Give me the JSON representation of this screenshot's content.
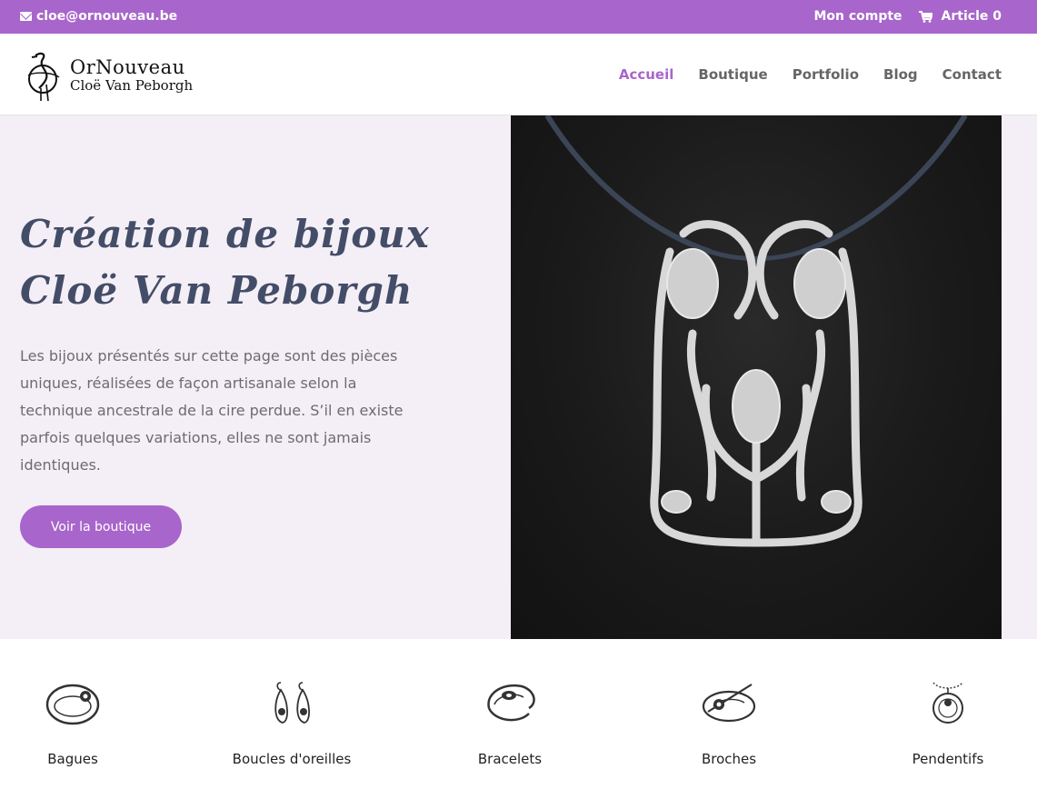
{
  "topbar": {
    "email": "cloe@ornouveau.be",
    "account": "Mon compte",
    "cart": "Article 0"
  },
  "logo": {
    "line1": "OrNouveau",
    "line2": "Cloë Van Peborgh"
  },
  "nav": [
    {
      "label": "Accueil",
      "active": true
    },
    {
      "label": "Boutique",
      "active": false
    },
    {
      "label": "Portfolio",
      "active": false
    },
    {
      "label": "Blog",
      "active": false
    },
    {
      "label": "Contact",
      "active": false
    }
  ],
  "hero": {
    "title_line1": "Création de bijoux",
    "title_line2": "Cloë Van Peborgh",
    "description": "Les bijoux présentés sur cette page sont des pièces uniques, réalisées de façon artisanale selon la technique ancestrale de la cire perdue. S’il en existe parfois quelques variations, elles ne sont jamais identiques.",
    "button": "Voir la boutique"
  },
  "categories": [
    {
      "label": "Bagues",
      "icon": "ring-icon"
    },
    {
      "label": "Boucles d'oreilles",
      "icon": "earrings-icon"
    },
    {
      "label": "Bracelets",
      "icon": "bracelet-icon"
    },
    {
      "label": "Broches",
      "icon": "brooch-icon"
    },
    {
      "label": "Pendentifs",
      "icon": "pendant-icon"
    }
  ],
  "colors": {
    "accent": "#a865cb",
    "hero_bg": "#f4eff6",
    "title": "#444d68"
  }
}
